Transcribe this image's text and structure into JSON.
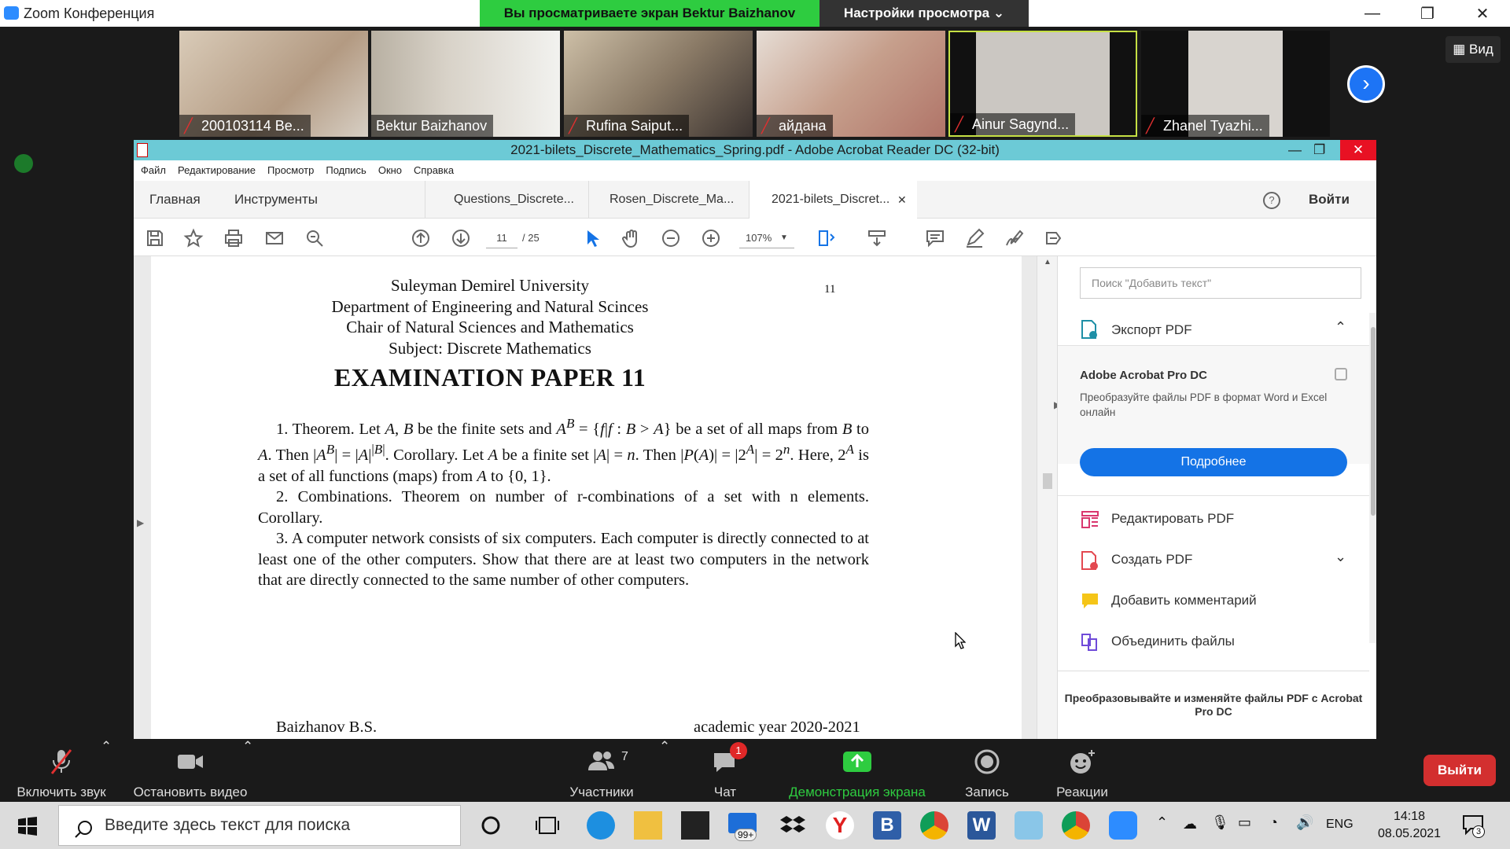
{
  "zoom": {
    "app_title": "Zoom Конференция",
    "share_banner": "Вы просматриваете экран Bektur Baizhanov",
    "view_settings": "Настройки просмотра",
    "view_label": "Вид",
    "participants": [
      {
        "name": "200103114 Be...",
        "muted": true
      },
      {
        "name": "Bektur Baizhanov",
        "muted": false
      },
      {
        "name": "Rufina Saiput...",
        "muted": true
      },
      {
        "name": "айдана",
        "muted": true
      },
      {
        "name": "Ainur Sagynd...",
        "muted": true
      },
      {
        "name": "Zhanel Tyazhi...",
        "muted": true
      }
    ],
    "toolbar": {
      "unmute": "Включить звук",
      "stop_video": "Остановить видео",
      "participants": "Участники",
      "participants_count": "7",
      "chat": "Чат",
      "chat_badge": "1",
      "share_screen": "Демонстрация экрана",
      "record": "Запись",
      "reactions": "Реакции",
      "exit": "Выйти"
    }
  },
  "acrobat": {
    "title": "2021-bilets_Discrete_Mathematics_Spring.pdf - Adobe Acrobat Reader DC (32-bit)",
    "menu": [
      "Файл",
      "Редактирование",
      "Просмотр",
      "Подпись",
      "Окно",
      "Справка"
    ],
    "tabs": {
      "home": "Главная",
      "tools": "Инструменты",
      "doc1": "Questions_Discrete...",
      "doc2": "Rosen_Discrete_Ma...",
      "doc3": "2021-bilets_Discret...",
      "signin": "Войти"
    },
    "toolbar": {
      "page_current": "11",
      "page_total": "/ 25",
      "zoom": "107%"
    },
    "right_pane": {
      "search_placeholder": "Поиск \"Добавить текст\"",
      "export": "Экспорт PDF",
      "acrobat_pro_title": "Adobe Acrobat Pro DC",
      "acrobat_pro_desc": "Преобразуйте файлы PDF в формат Word и Excel онлайн",
      "learn_more": "Подробнее",
      "tools": [
        "Редактировать PDF",
        "Создать PDF",
        "Добавить комментарий",
        "Объединить файлы"
      ],
      "promo": "Преобразовывайте и изменяйте файлы PDF с Acrobat Pro DC"
    }
  },
  "document": {
    "page_number": "11",
    "header_lines": [
      "Suleyman Demirel University",
      "Department of Engineering and Natural Scinces",
      "Chair of Natural Sciences and Mathematics",
      "Subject: Discrete Mathematics"
    ],
    "title": "EXAMINATION PAPER 11",
    "q2": "2. Combinations. Theorem on number of r-combinations of a set with n elements. Corollary.",
    "q3": "3. A computer network consists of six computers. Each computer is directly connected to at least one of the other computers. Show that there are at least two computers in the network that are directly connected to the same number of other computers.",
    "footer_left": "Baizhanov B.S.",
    "footer_right": "academic year 2020-2021"
  },
  "taskbar": {
    "search_placeholder": "Введите здесь текст для поиска",
    "mail_badge": "99+",
    "lang": "ENG",
    "time": "14:18",
    "date": "08.05.2021",
    "notifications": "3"
  }
}
